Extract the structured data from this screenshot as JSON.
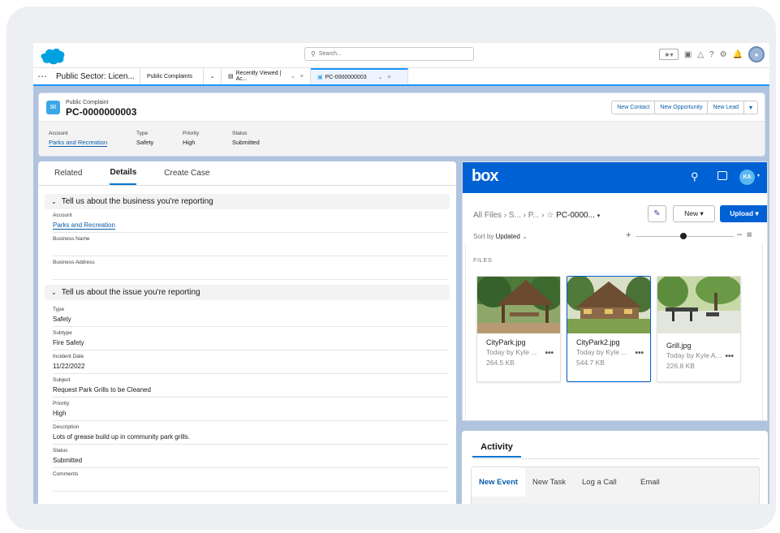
{
  "global": {
    "search_placeholder": "Search...",
    "utility_icons": [
      "favorites-icon",
      "add-icon",
      "trailhead-icon",
      "help-icon",
      "setup-icon",
      "notifications-icon",
      "user-avatar"
    ],
    "brand_color": "#00a1e0",
    "accent_color": "#0176d3"
  },
  "nav": {
    "app_name": "Public Sector: Licen...",
    "tabs": [
      {
        "label": "Public Complaints"
      },
      {
        "label": "Recently Viewed | Ac..."
      },
      {
        "label": "PC-0000000003",
        "active": true
      }
    ]
  },
  "record": {
    "type_label": "Public Complaint",
    "name": "PC-0000000003",
    "actions": [
      "New Contact",
      "New Opportunity",
      "New Lead"
    ],
    "highlights": [
      {
        "label": "Account",
        "value": "Parks and Recreation",
        "link": true
      },
      {
        "label": "Type",
        "value": "Safety"
      },
      {
        "label": "Priority",
        "value": "High"
      },
      {
        "label": "Status",
        "value": "Submitted"
      }
    ]
  },
  "details": {
    "tabs": [
      "Related",
      "Details",
      "Create Case"
    ],
    "active_tab": "Details",
    "section1": {
      "title": "Tell us about the business you're reporting",
      "fields": [
        {
          "label": "Account",
          "value": "Parks and Recreation",
          "link": true
        },
        {
          "label": "Business Name",
          "value": ""
        },
        {
          "label": "Business Address",
          "value": ""
        }
      ]
    },
    "section2": {
      "title": "Tell us about the issue you're reporting",
      "fields": [
        {
          "label": "Type",
          "value": "Safety"
        },
        {
          "label": "Subtype",
          "value": "Fire Safety"
        },
        {
          "label": "Incident Date",
          "value": "11/22/2022"
        },
        {
          "label": "Subject",
          "value": "Request Park Grills to be Cleaned"
        },
        {
          "label": "Priority",
          "value": "High"
        },
        {
          "label": "Description",
          "value": "Lots of grease build up in community park grills."
        },
        {
          "label": "Status",
          "value": "Submitted"
        },
        {
          "label": "Comments",
          "value": ""
        }
      ]
    }
  },
  "box": {
    "logo": "box",
    "avatar": "KA",
    "breadcrumb": "All Files › S... › P... › ☆",
    "breadcrumb_current": "PC-0000...",
    "new_label": "New ▾",
    "upload_label": "Upload ▾",
    "sort_prefix": "Sort by",
    "sort_value": "Updated",
    "files_label": "FILES",
    "files": [
      {
        "name": "CityPark.jpg",
        "meta": "Today by Kyle ...",
        "size": "264.5 KB"
      },
      {
        "name": "CityPark2.jpg",
        "meta": "Today by Kyle ...",
        "size": "544.7 KB",
        "selected": true
      },
      {
        "name": "Grill.jpg",
        "meta": "Today by Kyle A...",
        "size": "226.8 KB"
      }
    ],
    "brand_color": "#0061d5"
  },
  "activity": {
    "title": "Activity",
    "tabs": [
      "New Event",
      "New Task",
      "Log a Call",
      "Email"
    ]
  }
}
